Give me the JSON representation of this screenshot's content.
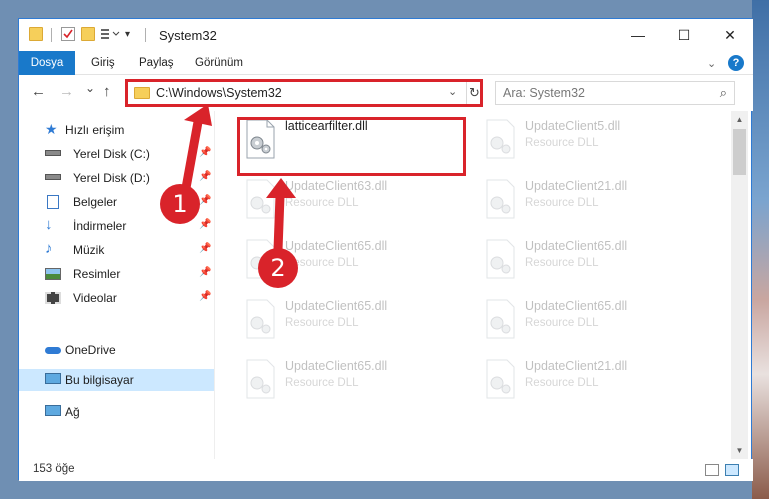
{
  "window": {
    "title": "System32",
    "controls": {
      "minimize": "—",
      "maximize": "☐",
      "close": "✕"
    }
  },
  "ribbon": {
    "tabs": [
      "Dosya",
      "Giriş",
      "Paylaş",
      "Görünüm"
    ],
    "help": "?"
  },
  "nav": {
    "back": "←",
    "forward": "→",
    "recent": "⌄",
    "up": "↑",
    "address": "C:\\Windows\\System32",
    "search_placeholder": "Ara: System32"
  },
  "sidebar": {
    "quick_access": "Hızlı erişim",
    "items": [
      {
        "label": "Yerel Disk (C:)",
        "icon": "drive-icon",
        "pinned": true
      },
      {
        "label": "Yerel Disk (D:)",
        "icon": "drive-icon",
        "pinned": true
      },
      {
        "label": "Belgeler",
        "icon": "documents-icon",
        "pinned": true
      },
      {
        "label": "İndirmeler",
        "icon": "download-icon",
        "pinned": true
      },
      {
        "label": "Müzik",
        "icon": "music-icon",
        "pinned": true
      },
      {
        "label": "Resimler",
        "icon": "pictures-icon",
        "pinned": true
      },
      {
        "label": "Videolar",
        "icon": "videos-icon",
        "pinned": true
      }
    ],
    "onedrive": "OneDrive",
    "this_pc": "Bu bilgisayar",
    "network": "Ağ"
  },
  "files": [
    {
      "name": "latticearfilter.dll",
      "type": "",
      "highlighted": true
    },
    {
      "name": "UpdateClient5.dll",
      "type": "Resource DLL"
    },
    {
      "name": "UpdateClient63.dll",
      "type": "Resource DLL"
    },
    {
      "name": "UpdateClient21.dll",
      "type": "Resource DLL"
    },
    {
      "name": "UpdateClient65.dll",
      "type": "Resource DLL"
    },
    {
      "name": "UpdateClient65.dll",
      "type": "Resource DLL"
    },
    {
      "name": "UpdateClient65.dll",
      "type": "Resource DLL"
    },
    {
      "name": "UpdateClient65.dll",
      "type": "Resource DLL"
    },
    {
      "name": "UpdateClient65.dll",
      "type": "Resource DLL"
    },
    {
      "name": "UpdateClient21.dll",
      "type": "Resource DLL"
    }
  ],
  "status": {
    "count": "153 öğe"
  },
  "annotations": {
    "step1": "1",
    "step2": "2",
    "color": "#d9232a"
  }
}
